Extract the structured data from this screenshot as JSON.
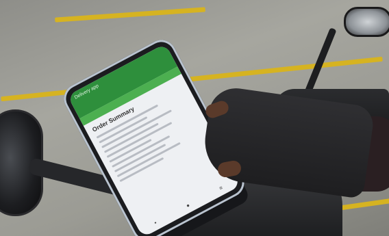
{
  "photo": {
    "subject": "Delivery rider holding a smartphone in a handlebar mount on a scooter"
  },
  "phone_screen": {
    "app_header_title": "Delivery app",
    "section_heading": "Order Summary"
  },
  "colors": {
    "app_header": "#2e8f3c",
    "parking_stripe": "#d6b321",
    "glove": "#2a2a2d"
  }
}
